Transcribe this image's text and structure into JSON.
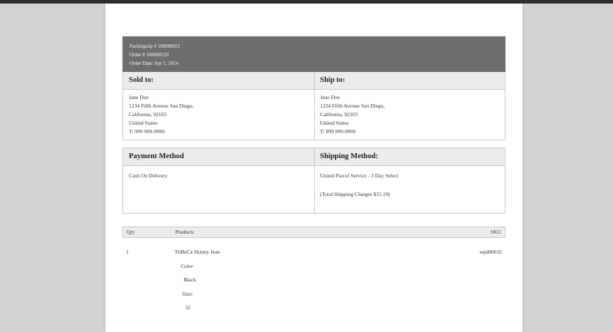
{
  "header": {
    "packingslip": "Packingslip # 100000021",
    "order": "Order # 100000220",
    "order_date": "Order Date: Apr 1, 2014"
  },
  "sold_to": {
    "title": "Sold to:",
    "name": "Jane Doe",
    "street": "1234 Fifth Avenue San Diego,",
    "city": "California, 92103",
    "country": "United States",
    "phone": "T: 999 999-9999"
  },
  "ship_to": {
    "title": "Ship to:",
    "name": "Jane Doe",
    "street": "1234 Fifth Avenue San Diego,",
    "city": "California, 92103",
    "country": "United States",
    "phone": "T: 999 999-9999"
  },
  "payment": {
    "title": "Payment Method",
    "method": "Cash On Delivery"
  },
  "shipping": {
    "title": "Shipping Method:",
    "method": "United Parcel Service - 3 Day Select",
    "total": "(Total Shipping Charges $15.19)"
  },
  "items": {
    "headers": {
      "qty": "Qty",
      "products": "Products",
      "sku": "SKU"
    },
    "rows": [
      {
        "qty": "1",
        "name": "TriBeCa Skinny Jean",
        "sku": "wpd00032",
        "options": [
          {
            "label": "Color",
            "value": "Black"
          },
          {
            "label": "Size",
            "value": "32"
          }
        ]
      }
    ]
  },
  "colors": {
    "header_bg": "#6e6e6e",
    "box_title_bg": "#ececec",
    "viewer_bg": "#d3d3d3"
  }
}
